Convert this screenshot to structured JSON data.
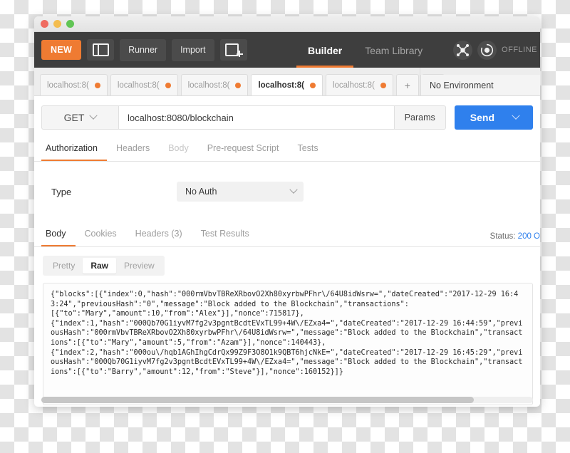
{
  "window": {
    "traffic_lights": [
      "close",
      "minimize",
      "maximize"
    ]
  },
  "toolbar": {
    "new_label": "NEW",
    "sidebar_toggle_name": "sidebar-toggle",
    "runner_label": "Runner",
    "import_label": "Import",
    "new_window_name": "new-window",
    "nav_tabs": [
      {
        "label": "Builder",
        "active": true
      },
      {
        "label": "Team Library",
        "active": false
      }
    ],
    "scan_icon": "scan-icon",
    "sync_icon": "sync-icon",
    "offline_label": "OFFLINE"
  },
  "request_tabs": {
    "tabs": [
      {
        "label": "localhost:8(",
        "active": false,
        "unsaved": true
      },
      {
        "label": "localhost:8(",
        "active": false,
        "unsaved": true
      },
      {
        "label": "localhost:8(",
        "active": false,
        "unsaved": true
      },
      {
        "label": "localhost:8(",
        "active": true,
        "unsaved": true
      },
      {
        "label": "localhost:8(",
        "active": false,
        "unsaved": true
      }
    ],
    "add_label": "+",
    "more_label": "•••"
  },
  "environment": {
    "selected": "No Environment"
  },
  "url_bar": {
    "method": "GET",
    "url": "localhost:8080/blockchain",
    "params_label": "Params",
    "send_label": "Send"
  },
  "request_section": {
    "tabs": [
      {
        "label": "Authorization",
        "active": true,
        "dim": false
      },
      {
        "label": "Headers",
        "active": false,
        "dim": false
      },
      {
        "label": "Body",
        "active": false,
        "dim": true
      },
      {
        "label": "Pre-request Script",
        "active": false,
        "dim": false
      },
      {
        "label": "Tests",
        "active": false,
        "dim": false
      }
    ],
    "type_label": "Type",
    "auth_type_value": "No Auth"
  },
  "response_section": {
    "tabs": [
      {
        "label": "Body",
        "active": true
      },
      {
        "label": "Cookies",
        "active": false
      },
      {
        "label": "Headers (3)",
        "active": false
      },
      {
        "label": "Test Results",
        "active": false
      }
    ],
    "status_label": "Status:",
    "status_value": "200 O",
    "format_tabs": [
      {
        "label": "Pretty",
        "active": false
      },
      {
        "label": "Raw",
        "active": true
      },
      {
        "label": "Preview",
        "active": false
      }
    ],
    "body_text": "{\"blocks\":[{\"index\":0,\"hash\":\"000rmVbvTBReXRbovO2Xh80xyrbwPFhr\\/64U8idWsrw=\",\"dateCreated\":\"2017-12-29 16:43:24\",\"previousHash\":\"0\",\"message\":\"Block added to the Blockchain\",\"transactions\":\n[{\"to\":\"Mary\",\"amount\":10,\"from\":\"Alex\"}],\"nonce\":715817},\n{\"index\":1,\"hash\":\"000Qb70G1iyvM7fg2v3pgntBcdtEVxTL99+4W\\/EZxa4=\",\"dateCreated\":\"2017-12-29 16:44:59\",\"previousHash\":\"000rmVbvTBReXRbovO2Xh80xyrbwPFhr\\/64U8idWsrw=\",\"message\":\"Block added to the Blockchain\",\"transactions\":[{\"to\":\"Mary\",\"amount\":5,\"from\":\"Azam\"}],\"nonce\":140443},\n{\"index\":2,\"hash\":\"000ou\\/hqb1AGhIhgCdrQx99Z9F3O8O1k9QBT6hjcNkE=\",\"dateCreated\":\"2017-12-29 16:45:29\",\"previousHash\":\"000Qb70G1iyvM7fg2v3pgntBcdtEVxTL99+4W\\/EZxa4=\",\"message\":\"Block added to the Blockchain\",\"transactions\":[{\"to\":\"Barry\",\"amount\":12,\"from\":\"Steve\"}],\"nonce\":160152}]}"
  },
  "colors": {
    "accent_orange": "#ef7b32",
    "send_blue": "#2f80ed",
    "toolbar_dark": "#3e3e3e",
    "status_blue": "#2f80ed"
  }
}
